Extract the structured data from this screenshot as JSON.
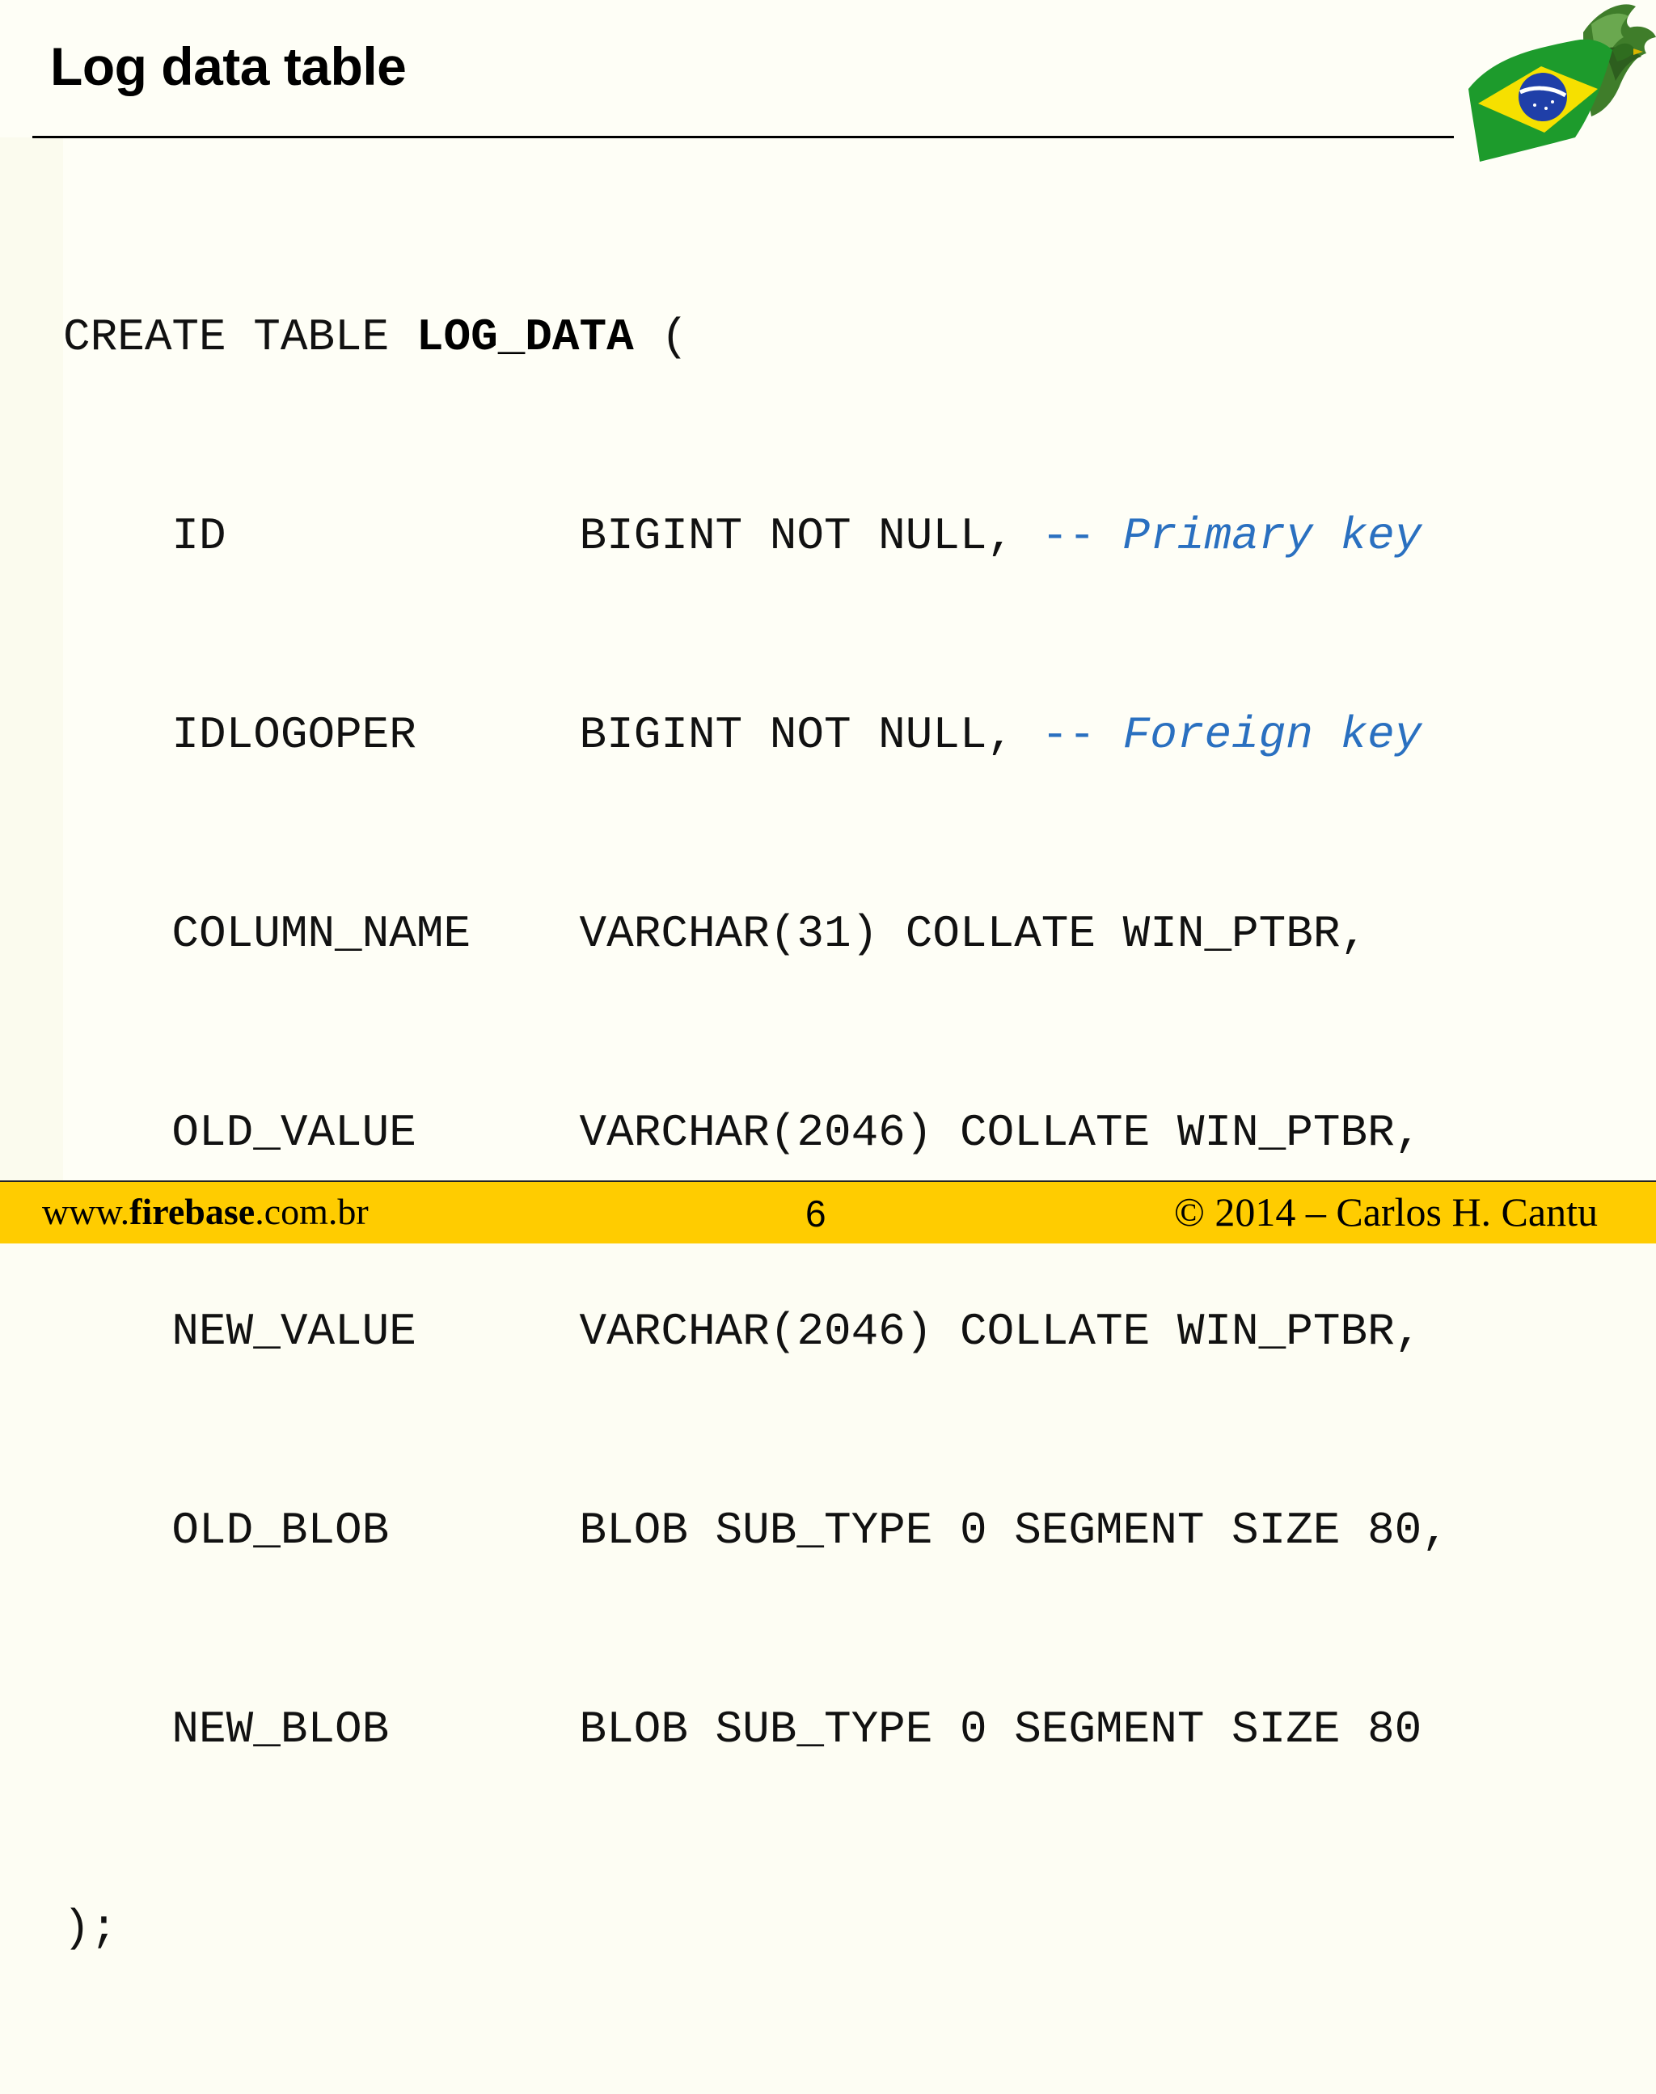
{
  "slide": {
    "title": "Log data table"
  },
  "code": {
    "lines": [
      {
        "pre": "CREATE TABLE ",
        "bold": "LOG_DATA",
        "post": " ("
      },
      {
        "col": "ID",
        "type": "BIGINT NOT NULL, ",
        "comment_dash": "-- ",
        "comment_text": "Primary key"
      },
      {
        "col": "IDLOGOPER",
        "type": "BIGINT NOT NULL, ",
        "comment_dash": "-- ",
        "comment_text": "Foreign key"
      },
      {
        "col": "COLUMN_NAME",
        "type": "VARCHAR(31) COLLATE WIN_PTBR,"
      },
      {
        "col": "OLD_VALUE",
        "type": "VARCHAR(2046) COLLATE WIN_PTBR,"
      },
      {
        "col": "NEW_VALUE",
        "type": "VARCHAR(2046) COLLATE WIN_PTBR,"
      },
      {
        "col": "OLD_BLOB",
        "type": "BLOB SUB_TYPE 0 SEGMENT SIZE 80,"
      },
      {
        "col": "NEW_BLOB",
        "type": "BLOB SUB_TYPE 0 SEGMENT SIZE 80"
      },
      {
        "pre": ");"
      }
    ]
  },
  "footer": {
    "url_prefix": "www.",
    "url_bold": "firebase",
    "url_suffix": ".com.br",
    "page_number": "6",
    "copyright": "© 2014 – Carlos H. Cantu"
  },
  "colors": {
    "background": "#fefef6",
    "footer_bar": "#ffcc00",
    "comment": "#2a70c0"
  },
  "icons": {
    "logo": "brazil-flag-eagle-icon"
  }
}
